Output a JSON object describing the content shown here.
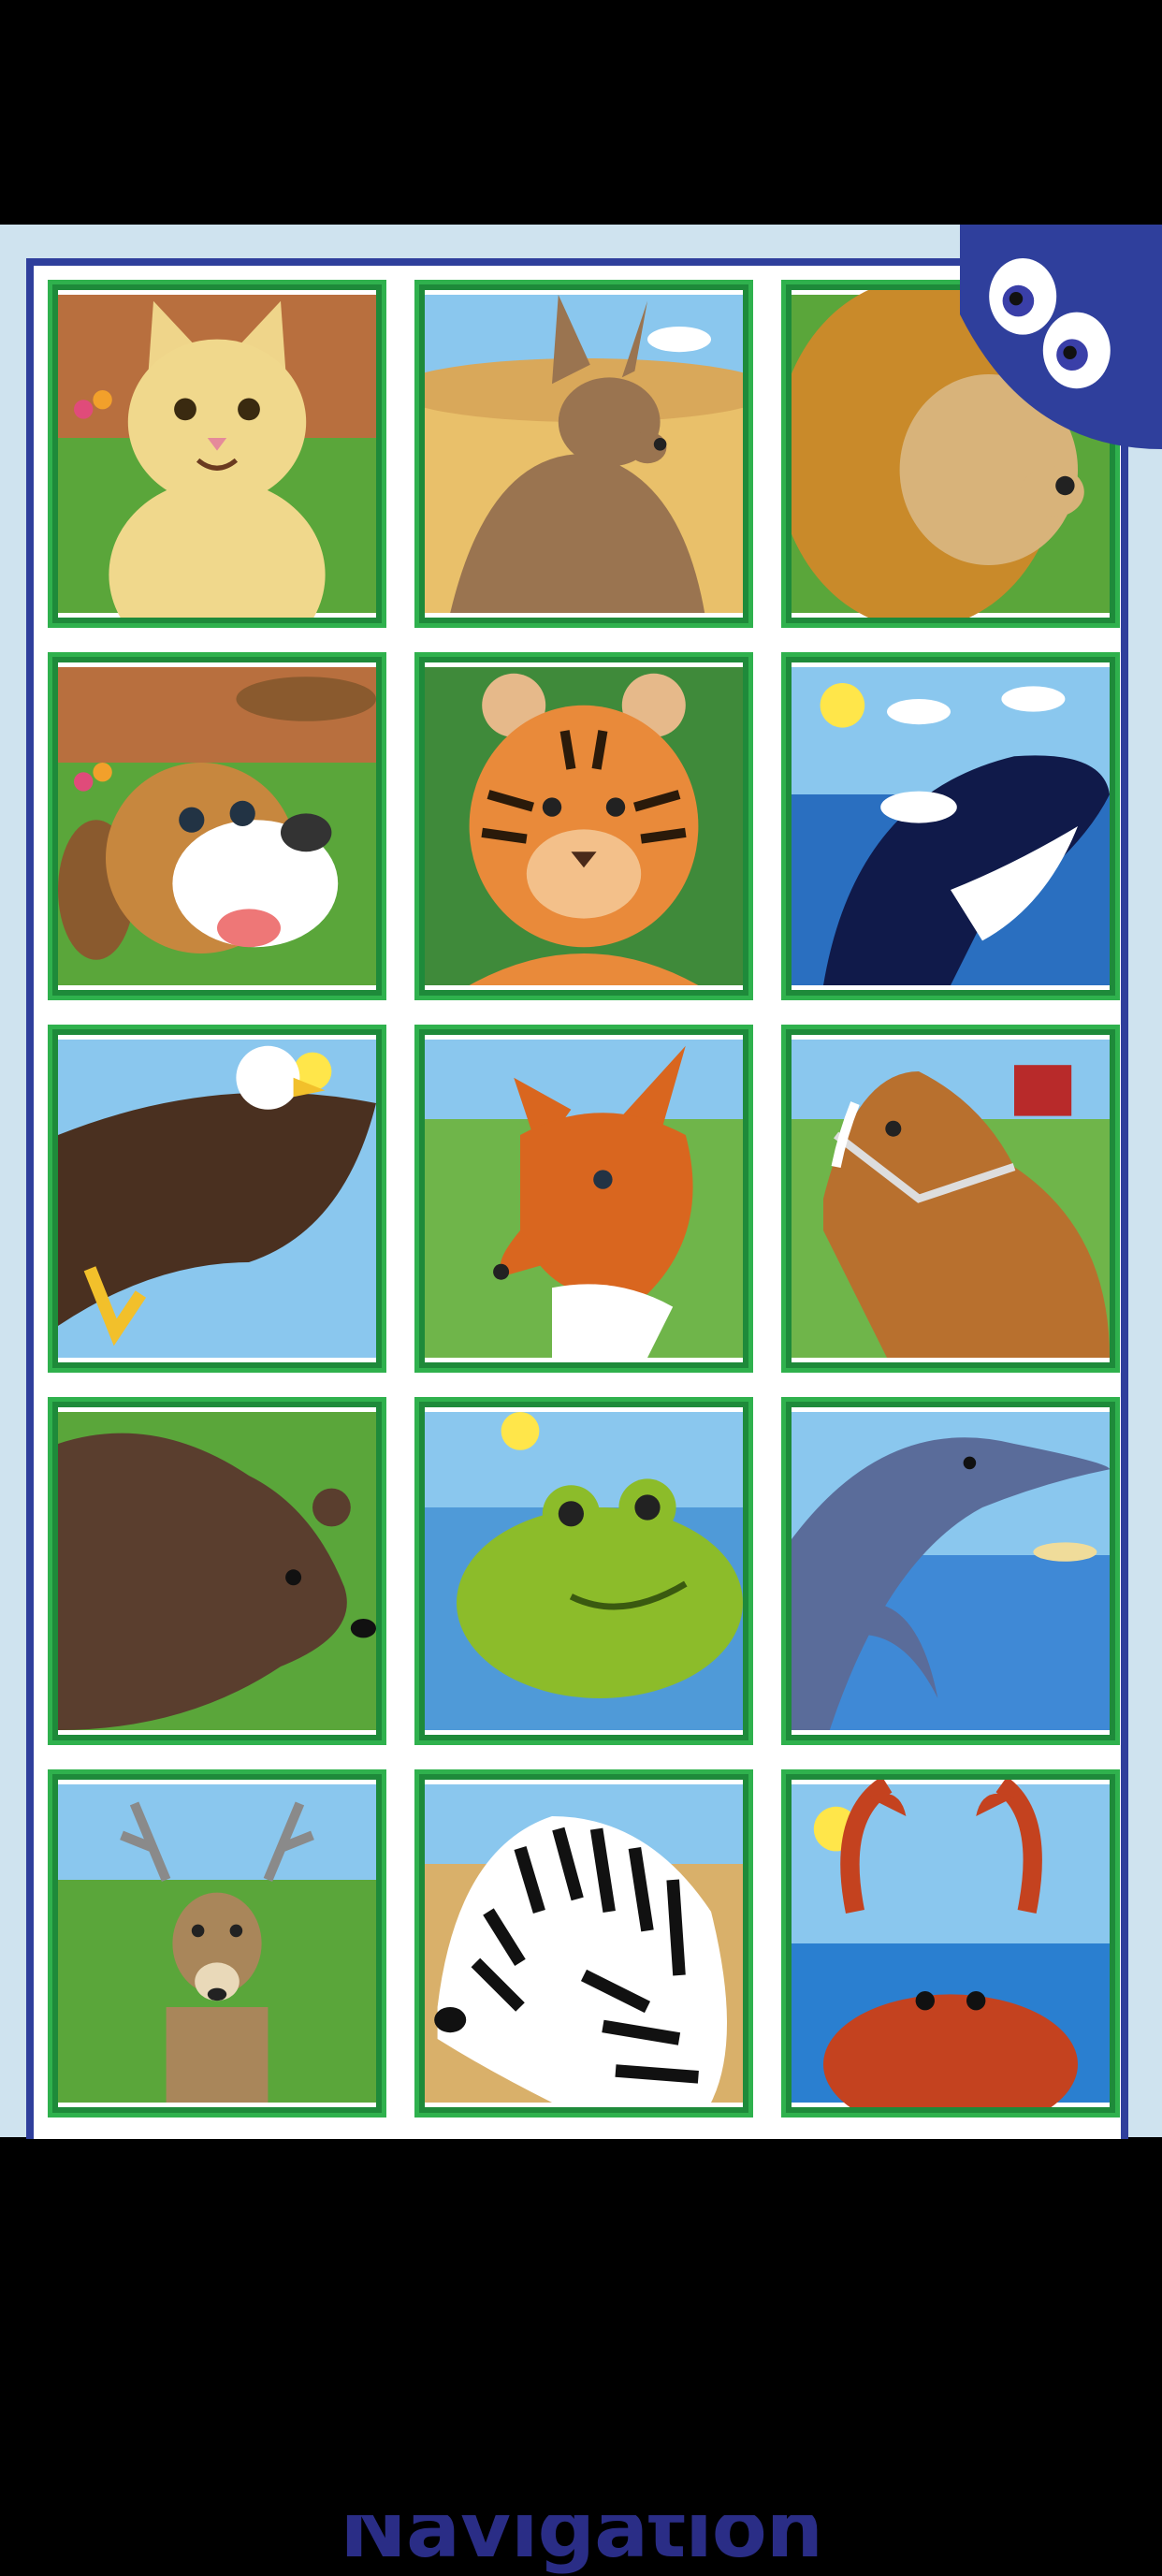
{
  "headline": "Featuring Unique Navigation",
  "tiles": [
    {
      "animal": "cat",
      "icon": "cat-icon"
    },
    {
      "animal": "kangaroo",
      "icon": "kangaroo-icon"
    },
    {
      "animal": "lion",
      "icon": "lion-icon"
    },
    {
      "animal": "dog",
      "icon": "dog-icon"
    },
    {
      "animal": "tiger",
      "icon": "tiger-icon"
    },
    {
      "animal": "orca",
      "icon": "orca-icon"
    },
    {
      "animal": "eagle",
      "icon": "eagle-icon"
    },
    {
      "animal": "fox",
      "icon": "fox-icon"
    },
    {
      "animal": "horse",
      "icon": "horse-icon"
    },
    {
      "animal": "bear",
      "icon": "bear-icon"
    },
    {
      "animal": "frog",
      "icon": "frog-icon"
    },
    {
      "animal": "dolphin",
      "icon": "dolphin-icon"
    },
    {
      "animal": "deer",
      "icon": "deer-icon"
    },
    {
      "animal": "zebra",
      "icon": "zebra-icon"
    },
    {
      "animal": "crab",
      "icon": "crab-icon"
    }
  ],
  "colors": {
    "tile_border": "#2fb14d",
    "frame_blue": "#2f3f9c",
    "headline_color": "#2a2d86"
  }
}
